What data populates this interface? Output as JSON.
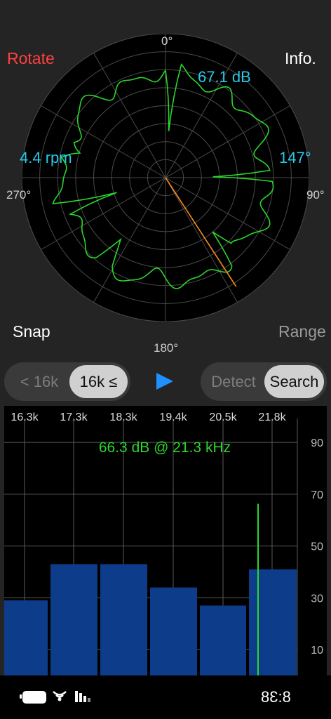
{
  "polar": {
    "angle_labels": {
      "top": "0°",
      "right": "90°",
      "bottom": "180°",
      "left": "270°"
    },
    "level_readout": "67.1 dB",
    "rotation_speed": "4.4 rpm",
    "angle_readout": "147°",
    "pointer_angle_deg": 147,
    "colors": {
      "trace": "#2bd62b",
      "pointer": "#ff8c1a",
      "grid": "#4a4a4a",
      "readout": "#28c8e8"
    }
  },
  "buttons": {
    "rotate": "Rotate",
    "info": "Info.",
    "snap": "Snap",
    "range": "Range"
  },
  "band_toggle": {
    "below": "< 16k",
    "above": "16k ≤",
    "selected": "16k ≤"
  },
  "mode_toggle": {
    "detect": "Detect",
    "search": "Search",
    "selected": "Search"
  },
  "play_icon": "play-icon",
  "spectrum": {
    "peak_readout": "66.3 dB @ 21.3 kHz",
    "freq_labels": [
      "16.3k",
      "17.3k",
      "18.3k",
      "19.4k",
      "20.5k",
      "21.8k"
    ],
    "db_labels": [
      "90",
      "70",
      "50",
      "30",
      "10"
    ],
    "bar_values": [
      29,
      43,
      43,
      34,
      27,
      41
    ],
    "peak_line_db": 66.3,
    "colors": {
      "bar": "#0d3d8a",
      "peak": "#2bd62b",
      "readout": "#2bd62b"
    }
  },
  "status_bar": {
    "time": "8:38"
  }
}
